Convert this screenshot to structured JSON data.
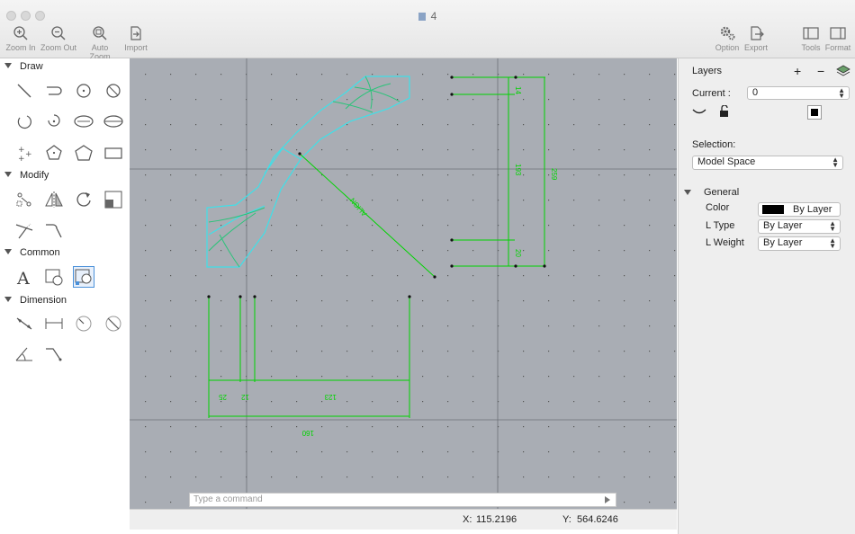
{
  "window": {
    "title": "4"
  },
  "toolbar": {
    "zoom_in": "Zoom In",
    "zoom_out": "Zoom Out",
    "auto_zoom": "Auto Zoom",
    "import": "Import",
    "option": "Option",
    "export": "Export",
    "tools": "Tools",
    "format": "Format"
  },
  "left_panel": {
    "sections": {
      "draw": "Draw",
      "modify": "Modify",
      "common": "Common",
      "dimension": "Dimension"
    },
    "draw_tools": [
      "line-icon",
      "polyline-icon",
      "circle-center-icon",
      "circle-2p-icon",
      "arc-3p-icon",
      "arc-center-icon",
      "ellipse-icon",
      "ellipse-axis-icon",
      "point-icon",
      "pentagon-inscribed-icon",
      "polygon-icon",
      "rectangle-icon"
    ],
    "modify_tools": [
      "move-icon",
      "mirror-icon",
      "rotate-icon",
      "scale-icon",
      "trim-icon",
      "fillet-icon"
    ],
    "common_tools": [
      "text-icon",
      "block-icon",
      "insert-block-icon"
    ],
    "dimension_tools": [
      "aligned-dimension-icon",
      "linear-dimension-icon",
      "radius-dimension-icon",
      "diameter-dimension-icon",
      "angular-dimension-icon",
      "leader-icon"
    ]
  },
  "canvas": {
    "dimension_labels": [
      "14",
      "193",
      "259",
      "20",
      "ALIGN",
      "25",
      "12",
      "123",
      "160"
    ],
    "command_placeholder": "Type a command"
  },
  "status": {
    "x_label": "X:",
    "x_value": "115.2196",
    "y_label": "Y:",
    "y_value": "564.6246"
  },
  "right_panel": {
    "layers_title": "Layers",
    "add": "+",
    "remove": "−",
    "current_label": "Current :",
    "current_value": "0",
    "selection_label": "Selection:",
    "selection_value": "Model Space",
    "general_title": "General",
    "color_label": "Color",
    "color_value": "By Layer",
    "color_swatch": "#000000",
    "ltype_label": "L Type",
    "ltype_value": "By Layer",
    "lweight_label": "L Weight",
    "lweight_value": "By Layer"
  },
  "colors": {
    "canvas_bg": "#a9adb4",
    "dimension_green": "#00d400",
    "shape_cyan": "#3fe0e8",
    "accent_blue": "#4a90d9"
  }
}
